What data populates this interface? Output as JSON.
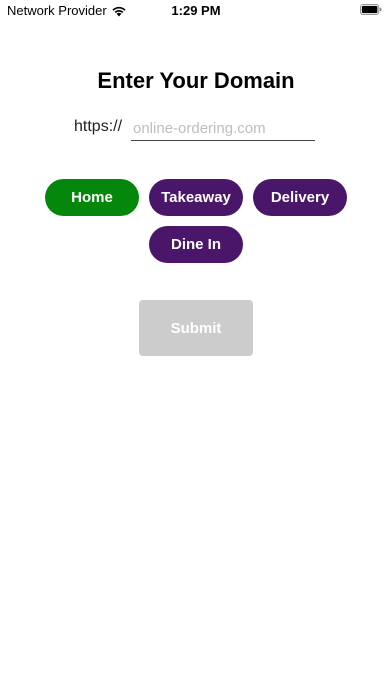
{
  "status_bar": {
    "carrier": "Network Provider",
    "time": "1:29 PM",
    "wifi_icon": "wifi-icon",
    "battery_icon": "battery-icon"
  },
  "title": "Enter Your Domain",
  "url": {
    "prefix": "https://",
    "value": "",
    "placeholder": "online-ordering.com"
  },
  "modes": {
    "home": "Home",
    "takeaway": "Takeaway",
    "delivery": "Delivery",
    "dine_in": "Dine In",
    "selected": "Home"
  },
  "submit_label": "Submit",
  "colors": {
    "selected": "#05870b",
    "unselected": "#4a1669",
    "disabled": "#cccccc"
  }
}
